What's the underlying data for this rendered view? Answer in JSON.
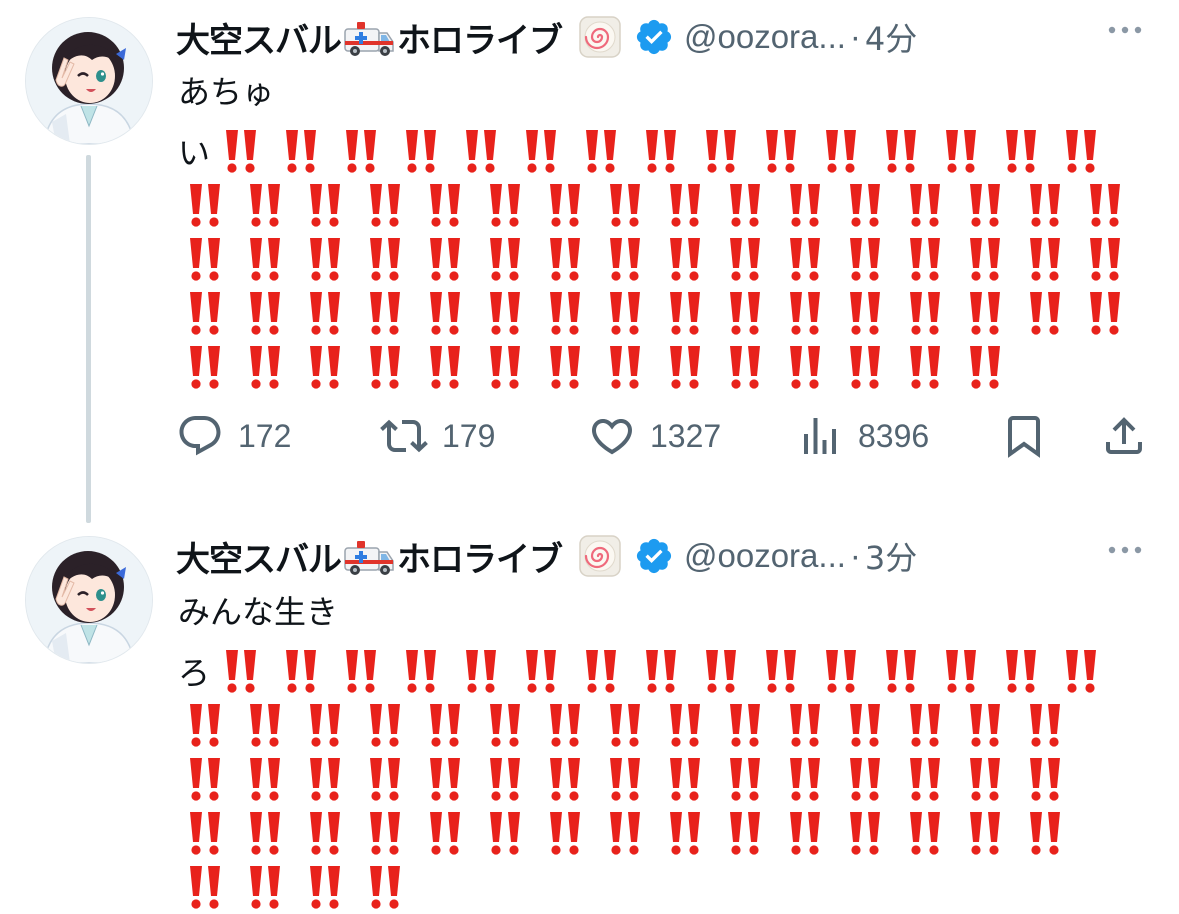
{
  "tweets": [
    {
      "display_name": "大空スバル",
      "name_suffix": "ホロライブ",
      "handle": "@oozora...",
      "separator": "·",
      "time": "4分",
      "text_line1": "あちゅ",
      "lead_char": "い",
      "bang_rows": [
        15,
        16,
        16,
        16,
        14
      ],
      "actions": {
        "replies": "172",
        "retweets": "179",
        "likes": "1327",
        "views": "8396"
      }
    },
    {
      "display_name": "大空スバル",
      "name_suffix": "ホロライブ",
      "handle": "@oozora...",
      "separator": "·",
      "time": "3分",
      "text_line1": "みんな生き",
      "lead_char": "ろ",
      "bang_rows": [
        15,
        15,
        15,
        15,
        4
      ]
    }
  ],
  "colors": {
    "bang_red": "#e8221b",
    "verified_blue": "#1d9bf0",
    "muted_text": "#536471",
    "thread_line": "#cfd9de"
  },
  "icons": {
    "reply": "reply-icon",
    "retweet": "retweet-icon",
    "like": "heart-icon",
    "views": "views-chart-icon",
    "bookmark": "bookmark-icon",
    "share": "share-icon",
    "more": "more-dots-icon",
    "verified": "verified-badge-icon",
    "org": "naruto-badge-icon",
    "ambulance": "ambulance-emoji-icon",
    "bang": "double-exclamation-emoji"
  }
}
